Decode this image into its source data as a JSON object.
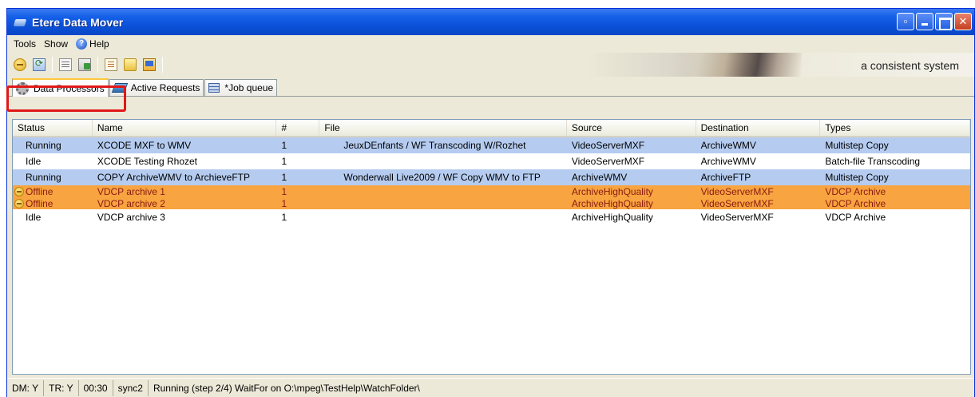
{
  "window": {
    "title": "Etere Data Mover"
  },
  "menu": {
    "tools": "Tools",
    "show": "Show",
    "help": "Help"
  },
  "toolbar": {
    "tagline": "a consistent system"
  },
  "tabs": [
    {
      "label": "Data Processors",
      "active": true
    },
    {
      "label": "Active Requests",
      "active": false
    },
    {
      "label": "*Job queue",
      "active": false
    }
  ],
  "columns": {
    "status": "Status",
    "name": "Name",
    "num": "#",
    "file": "File",
    "source": "Source",
    "destination": "Destination",
    "types": "Types"
  },
  "rows": [
    {
      "status": "Running",
      "name": "XCODE MXF to WMV",
      "num": "1",
      "file": "JeuxDEnfants / WF Transcoding W/Rozhet",
      "source": "VideoServerMXF",
      "destination": "ArchiveWMV",
      "types": "Multistep Copy",
      "state": "selected"
    },
    {
      "status": "Idle",
      "name": "XCODE Testing Rhozet",
      "num": "1",
      "file": "",
      "source": "VideoServerMXF",
      "destination": "ArchiveWMV",
      "types": "Batch-file Transcoding",
      "state": "normal"
    },
    {
      "status": "Running",
      "name": "COPY ArchiveWMV to ArchieveFTP",
      "num": "1",
      "file": "Wonderwall Live2009 / WF Copy WMV to FTP",
      "source": "ArchiveWMV",
      "destination": "ArchiveFTP",
      "types": "Multistep Copy",
      "state": "selected"
    },
    {
      "status": "Offline",
      "name": "VDCP archive 1",
      "num": "1",
      "file": "",
      "source": "ArchiveHighQuality",
      "destination": "VideoServerMXF",
      "types": "VDCP Archive",
      "state": "offline"
    },
    {
      "status": "Offline",
      "name": "VDCP archive 2",
      "num": "1",
      "file": "",
      "source": "ArchiveHighQuality",
      "destination": "VideoServerMXF",
      "types": "VDCP Archive",
      "state": "offline"
    },
    {
      "status": "Idle",
      "name": "VDCP archive 3",
      "num": "1",
      "file": "",
      "source": "ArchiveHighQuality",
      "destination": "VideoServerMXF",
      "types": "VDCP Archive",
      "state": "normal"
    }
  ],
  "statusbar": {
    "dm": "DM: Y",
    "tr": "TR: Y",
    "time": "00:30",
    "sync": "sync2",
    "message": "Running (step 2/4) WaitFor on O:\\mpeg\\TestHelp\\WatchFolder\\"
  },
  "colors": {
    "titlebar": "#0a4fd6",
    "selected_row": "#b5ccf0",
    "offline_row": "#f7a441",
    "offline_text": "#8b1a10",
    "tab_highlight": "#e01818"
  }
}
